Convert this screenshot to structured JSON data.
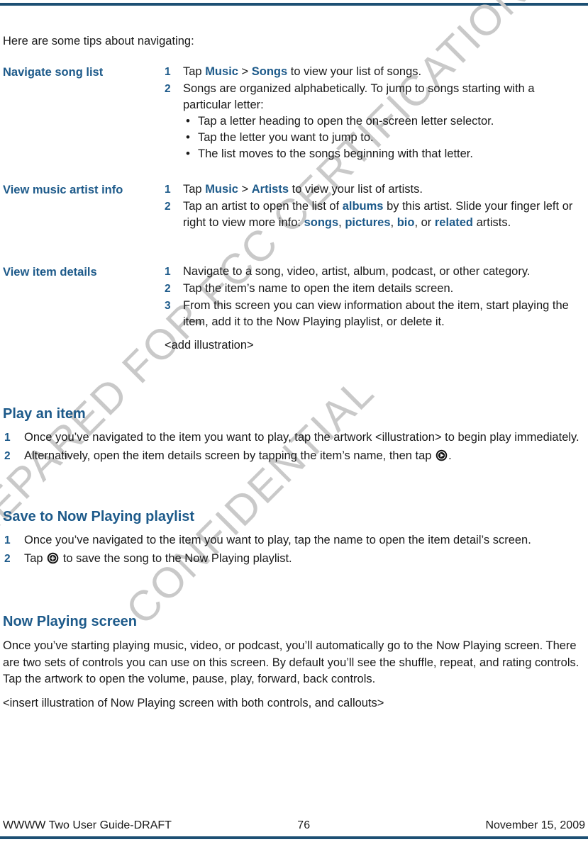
{
  "document": {
    "intro": "Here are some tips about navigating:",
    "colors": {
      "heading_blue": "#1d5a8a",
      "rule_blue": "#1c4f73",
      "watermark_gray": "#c9c9c9",
      "body_text": "#1a1a1a"
    }
  },
  "watermark": {
    "line1": "PREPARED FOR FCC CERTIFICATION",
    "line2": "CONFIDENTIAL"
  },
  "tips_table": [
    {
      "label": "Navigate song list",
      "steps": [
        {
          "num": "1",
          "parts": [
            {
              "text": "Tap ",
              "style": "normal"
            },
            {
              "text": "Music",
              "style": "blue"
            },
            {
              "text": " > ",
              "style": "normal"
            },
            {
              "text": "Songs",
              "style": "blue"
            },
            {
              "text": " to view your list of songs.",
              "style": "normal"
            }
          ]
        },
        {
          "num": "2",
          "parts": [
            {
              "text": "Songs are organized alphabetically. To jump to songs starting with a particular letter:",
              "style": "normal"
            }
          ],
          "bullets": [
            "Tap a letter heading to open the on-screen letter selector.",
            "Tap the letter you want to jump to.",
            "The list moves to the songs beginning with that letter."
          ]
        }
      ]
    },
    {
      "label": "View music artist info",
      "steps": [
        {
          "num": "1",
          "parts": [
            {
              "text": "Tap ",
              "style": "normal"
            },
            {
              "text": "Music",
              "style": "blue"
            },
            {
              "text": " > ",
              "style": "normal"
            },
            {
              "text": "Artists",
              "style": "blue"
            },
            {
              "text": " to view your list of artists.",
              "style": "normal"
            }
          ]
        },
        {
          "num": "2",
          "parts": [
            {
              "text": "Tap an artist to open the list of ",
              "style": "normal"
            },
            {
              "text": "albums",
              "style": "blue"
            },
            {
              "text": " by this artist. Slide your finger left or right to view more info: ",
              "style": "normal"
            },
            {
              "text": "songs",
              "style": "blue"
            },
            {
              "text": ", ",
              "style": "normal"
            },
            {
              "text": "pictures",
              "style": "blue"
            },
            {
              "text": ", ",
              "style": "normal"
            },
            {
              "text": "bio",
              "style": "blue"
            },
            {
              "text": ", or ",
              "style": "normal"
            },
            {
              "text": "related",
              "style": "blue"
            },
            {
              "text": " artists.",
              "style": "normal"
            }
          ]
        }
      ]
    },
    {
      "label": "View item details",
      "steps": [
        {
          "num": "1",
          "parts": [
            {
              "text": "Navigate to a song, video, artist, album, podcast, or other category.",
              "style": "normal"
            }
          ]
        },
        {
          "num": "2",
          "parts": [
            {
              "text": "Tap the item’s name to open the item details screen.",
              "style": "normal"
            }
          ]
        },
        {
          "num": "3",
          "parts": [
            {
              "text": "From this screen you can view information about the item, start playing the item, add it to the Now Playing playlist, or delete it.",
              "style": "normal"
            }
          ]
        }
      ],
      "note": "<add illustration>"
    }
  ],
  "sections": [
    {
      "id": "play-an-item",
      "heading": "Play an item",
      "steps": [
        {
          "num": "1",
          "segments": [
            {
              "kind": "text",
              "text": "Once you’ve navigated to the item you want to play, tap the artwork <illustration> to begin play immediately."
            }
          ]
        },
        {
          "num": "2",
          "segments": [
            {
              "kind": "text",
              "text": "Alternatively, open the item details screen by tapping the item’s name, then tap "
            },
            {
              "kind": "icon",
              "icon": "play-circle-icon"
            },
            {
              "kind": "text",
              "text": "."
            }
          ]
        }
      ]
    },
    {
      "id": "save-to-now-playing-playlist",
      "heading": "Save to Now Playing playlist",
      "steps": [
        {
          "num": "1",
          "segments": [
            {
              "kind": "text",
              "text": "Once you’ve navigated to the item you want to play, tap the name to open the item detail’s screen."
            }
          ]
        },
        {
          "num": "2",
          "segments": [
            {
              "kind": "text",
              "text": "Tap "
            },
            {
              "kind": "icon",
              "icon": "add-circle-icon"
            },
            {
              "kind": "text",
              "text": " to save the song to the Now Playing playlist."
            }
          ]
        }
      ]
    },
    {
      "id": "now-playing-screen",
      "heading": "Now Playing screen",
      "paragraph": "Once you’ve starting playing music, video, or podcast, you’ll automatically go to the Now Playing screen. There are two sets of controls you can use on this screen. By default you’ll see the shuffle, repeat, and rating controls. Tap the artwork to open the volume, pause, play, forward, back controls.",
      "note": "<insert illustration of Now Playing screen with both controls, and callouts>"
    }
  ],
  "footer": {
    "left": "WWWW Two User Guide-DRAFT",
    "page_number": "76",
    "right": "November 15, 2009"
  }
}
